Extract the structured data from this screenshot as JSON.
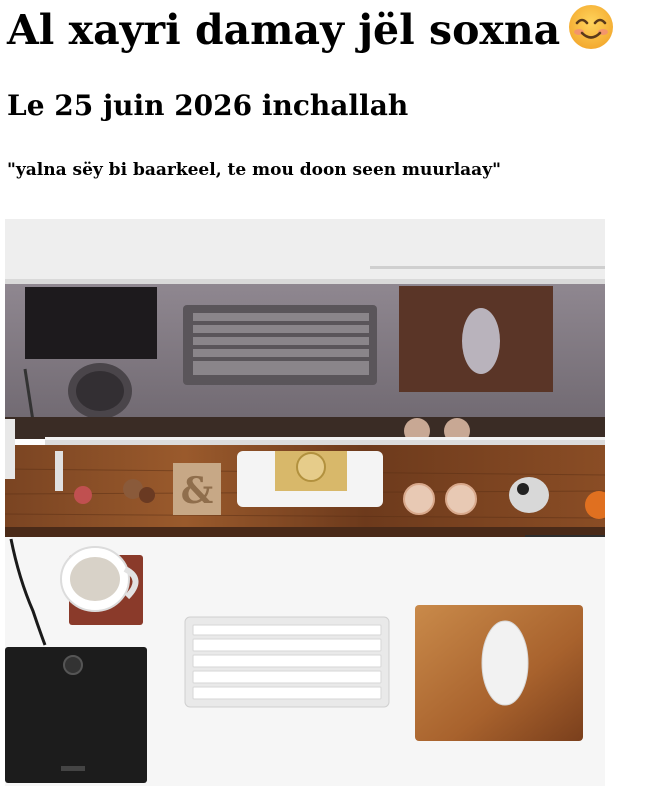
{
  "heading": "Al xayri damay jël soxna",
  "subheading": "Le 25 juin 2026 inchallah",
  "quote": "\"yalna sëy bi baarkeel, te mou doon seen muurlaay\"",
  "icons": {
    "heading_emoji": "smiling-face-with-smiling-eyes-icon"
  },
  "colors": {
    "text": "#000000",
    "background": "#ffffff",
    "emoji_face": "#f7b73b"
  }
}
